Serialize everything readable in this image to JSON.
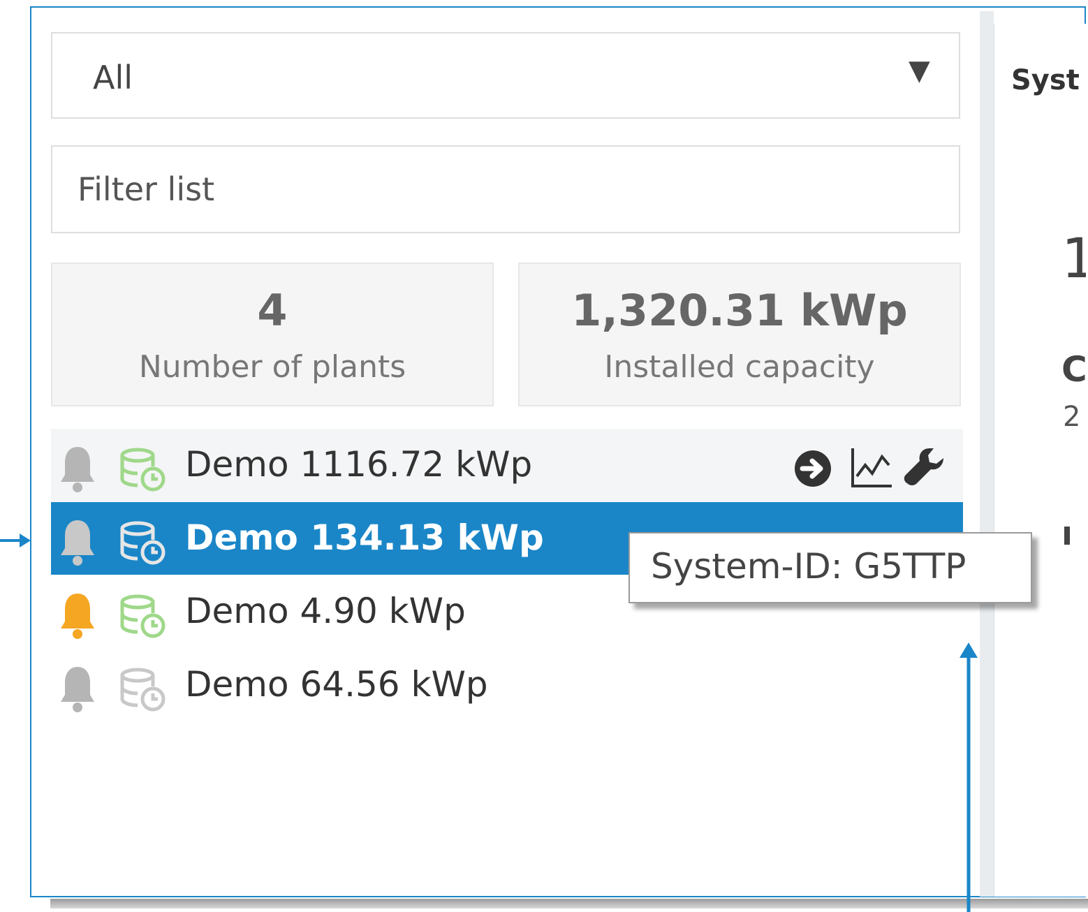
{
  "plant_type_select": {
    "value": "All"
  },
  "filter": {
    "placeholder": "Filter list"
  },
  "stats": {
    "plants_count": "4",
    "plants_label": "Number of plants",
    "capacity_value": "1,320.31 kWp",
    "capacity_label": "Installed capacity"
  },
  "plants": [
    {
      "name": "Demo 1116.72 kWp",
      "bell": "bell-icon",
      "bell_color": "#b5b5b5",
      "db_icon": "database-clock-icon",
      "db_color": "#9fd88a",
      "selected": false,
      "actions": [
        "go-arrow-icon",
        "chart-icon",
        "wrench-icon"
      ]
    },
    {
      "name": "Demo 134.13 kWp",
      "bell": "bell-icon",
      "bell_color": "#c8c8c8",
      "db_icon": "database-clock-icon",
      "db_color": "#e6e6e6",
      "selected": true
    },
    {
      "name": "Demo 4.90 kWp",
      "bell": "bell-icon",
      "bell_color": "#f5a623",
      "db_icon": "database-clock-icon",
      "db_color": "#9fd88a",
      "selected": false
    },
    {
      "name": "Demo 64.56 kWp",
      "bell": "bell-icon",
      "bell_color": "#b5b5b5",
      "db_icon": "database-clock-icon",
      "db_color": "#c8c8c8",
      "selected": false
    }
  ],
  "tooltip": {
    "text": "System-ID: G5TTP"
  },
  "right_panel": {
    "heading": "Syst",
    "big_fragment": "1",
    "bold_fragment": "C",
    "small_fragment": "2"
  },
  "colors": {
    "accent": "#1a86c8",
    "selected_row": "#1a86c8",
    "warning_bell": "#f5a623",
    "ok_green": "#9fd88a"
  }
}
